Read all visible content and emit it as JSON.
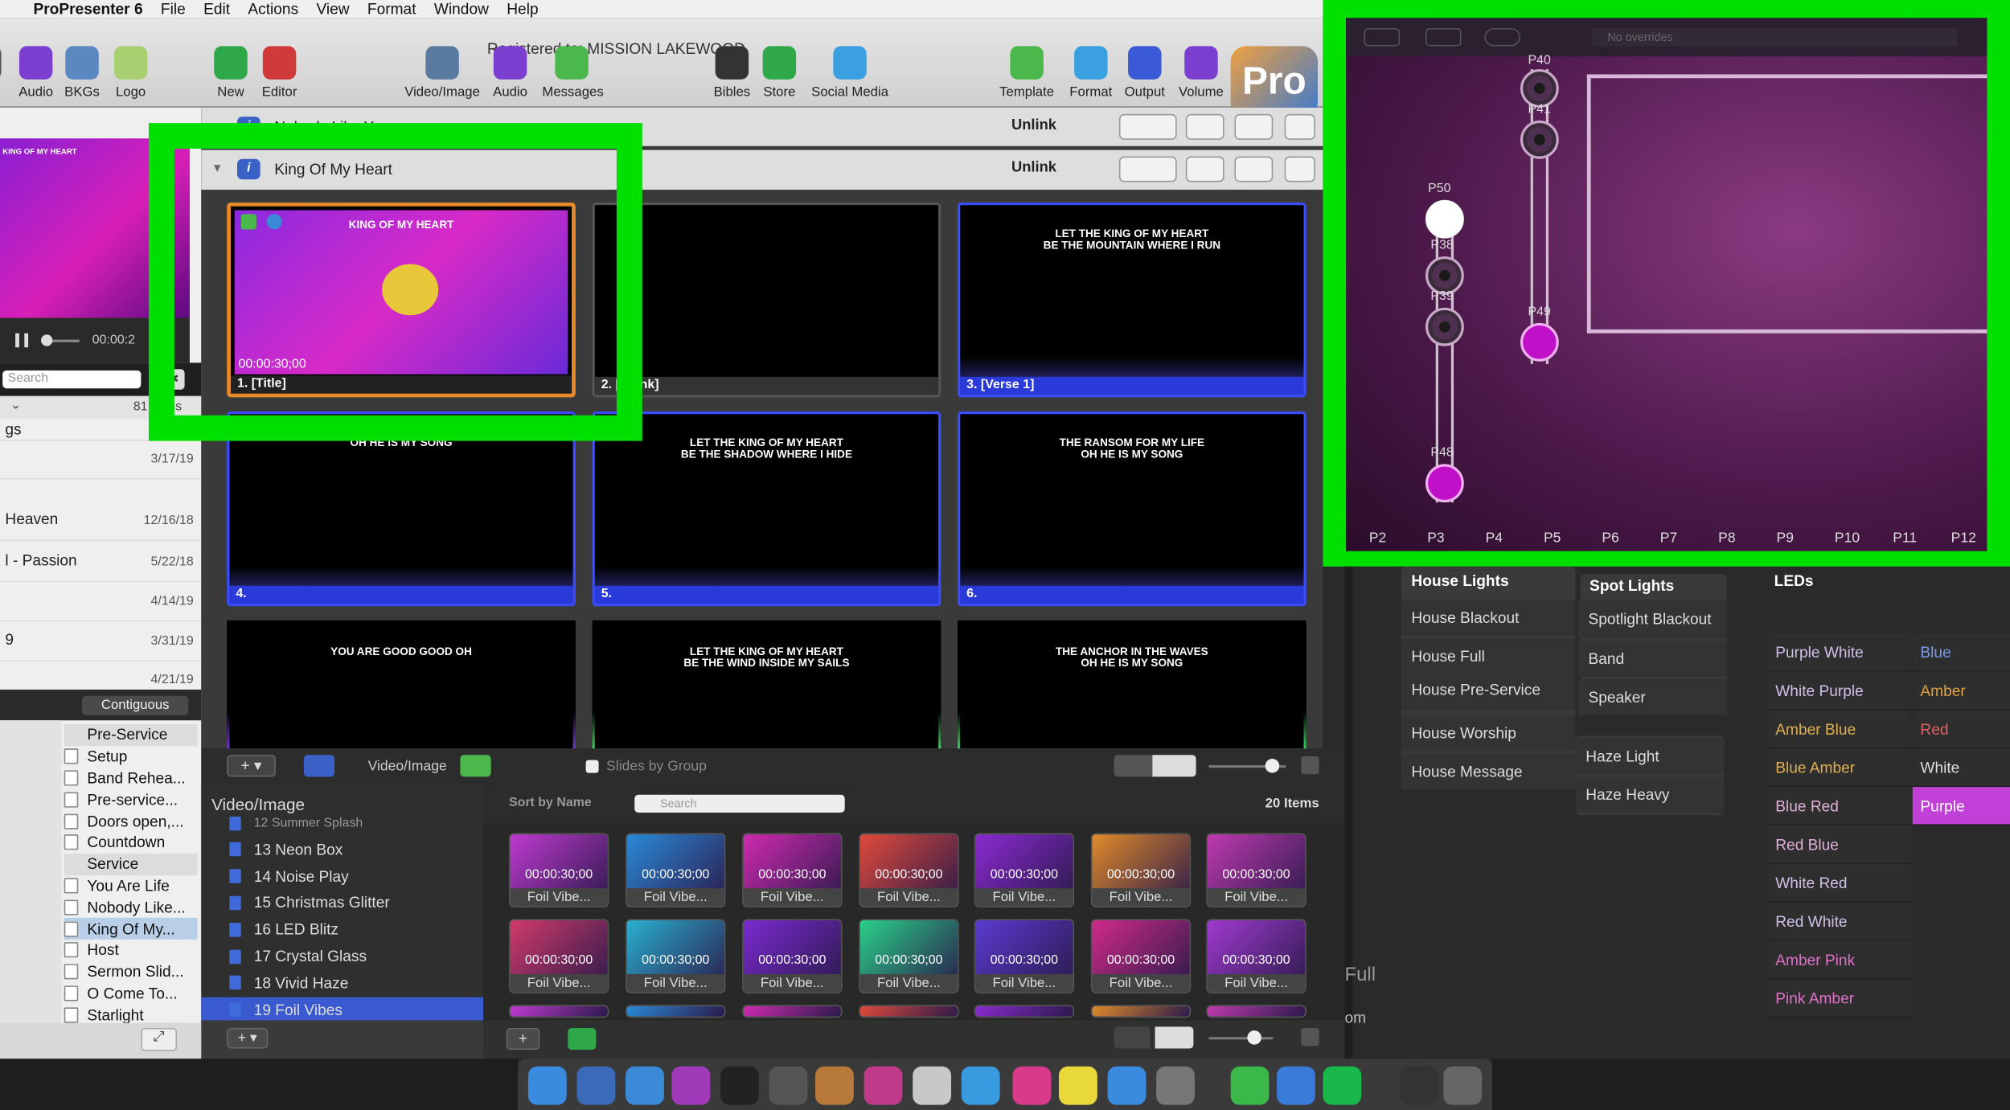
{
  "menubar": {
    "apple": "",
    "app": "ProPresenter 6",
    "items": [
      "File",
      "Edit",
      "Actions",
      "View",
      "Format",
      "Window",
      "Help"
    ]
  },
  "registered": "Registered to: MISSION LAKEWOOD",
  "toolbar": {
    "left": [
      {
        "label": "s",
        "icon": "play-icon",
        "color": "#555"
      },
      {
        "label": "Audio",
        "icon": "audio-icon",
        "color": "#7b3fd0"
      },
      {
        "label": "BKGs",
        "icon": "bkgs-icon",
        "color": "#5a88c0"
      },
      {
        "label": "Logo",
        "icon": "logo-icon",
        "color": "#a8d070"
      }
    ],
    "mid": [
      {
        "label": "New",
        "icon": "plus-icon",
        "color": "#2fa84a"
      },
      {
        "label": "Editor",
        "icon": "editor-icon",
        "color": "#d03a3a"
      }
    ],
    "media": [
      {
        "label": "Video/Image",
        "icon": "video-image-icon",
        "color": "#5a7aa0"
      },
      {
        "label": "Audio",
        "icon": "audio-icon",
        "color": "#7b3fd0"
      },
      {
        "label": "Messages",
        "icon": "messages-icon",
        "color": "#4ab84a"
      }
    ],
    "store": [
      {
        "label": "Bibles",
        "icon": "bible-icon",
        "color": "#333"
      },
      {
        "label": "Store",
        "icon": "store-icon",
        "color": "#2fa84a"
      },
      {
        "label": "Social Media",
        "icon": "social-icon",
        "color": "#3aa0e0"
      }
    ],
    "right": [
      {
        "label": "Template",
        "icon": "template-icon",
        "color": "#4ab84a"
      },
      {
        "label": "Format",
        "icon": "format-icon",
        "color": "#3aa0e0"
      },
      {
        "label": "Output",
        "icon": "output-icon",
        "color": "#3a5ad8"
      },
      {
        "label": "Volume",
        "icon": "volume-icon",
        "color": "#7b3fd0"
      }
    ],
    "pro": "Pro"
  },
  "left": {
    "preview_text": "KING OF MY HEART",
    "timecode": "00:00:2",
    "search_placeholder": "Search",
    "count": "81 items",
    "rows": [
      {
        "title": "gs",
        "date": ""
      },
      {
        "title": "",
        "date": "3/17/19"
      },
      {
        "title": " Heaven",
        "date": "12/16/18"
      },
      {
        "title": "l - Passion",
        "date": "5/22/18"
      },
      {
        "title": "",
        "date": "4/14/19"
      },
      {
        "title": "9",
        "date": "3/31/19"
      },
      {
        "title": "",
        "date": "4/21/19"
      }
    ],
    "contiguous": "Contiguous",
    "playlist": [
      {
        "label": "Pre-Service",
        "kind": "hdr"
      },
      {
        "label": "Setup",
        "kind": "doc"
      },
      {
        "label": "Band Rehea...",
        "kind": "doc"
      },
      {
        "label": "Pre-service...",
        "kind": "doc"
      },
      {
        "label": "Doors open,...",
        "kind": "doc"
      },
      {
        "label": "Countdown",
        "kind": "doc"
      },
      {
        "label": "Service",
        "kind": "hdr"
      },
      {
        "label": "You Are Life",
        "kind": "doc"
      },
      {
        "label": "Nobody Like...",
        "kind": "doc"
      },
      {
        "label": "King Of My...",
        "kind": "sel"
      },
      {
        "label": "Host",
        "kind": "doc"
      },
      {
        "label": "Sermon Slid...",
        "kind": "doc"
      },
      {
        "label": "O Come To...",
        "kind": "doc"
      },
      {
        "label": "Starlight",
        "kind": "doc"
      }
    ]
  },
  "groups": [
    {
      "name": "Nobody Like You",
      "unlink": "Unlink"
    },
    {
      "name": "King Of My Heart",
      "unlink": "Unlink"
    }
  ],
  "slides": [
    {
      "lyric": "KING OF MY HEART",
      "label": "1. [Title]",
      "time": "00:00:30;00",
      "style": "title"
    },
    {
      "lyric": "",
      "label": "2. [Blank]",
      "style": "gray"
    },
    {
      "lyric": "LET THE KING OF MY HEART\nBE THE MOUNTAIN WHERE I RUN",
      "label": "3. [Verse 1]",
      "style": "blue"
    },
    {
      "lyric": "OH HE IS MY SONG",
      "label": "4.",
      "style": "blue"
    },
    {
      "lyric": "LET THE KING OF MY HEART\nBE THE SHADOW WHERE I HIDE",
      "label": "5.",
      "style": "blue"
    },
    {
      "lyric": "THE RANSOM FOR MY LIFE\nOH HE IS MY SONG",
      "label": "6.",
      "style": "blue"
    },
    {
      "lyric": "YOU ARE GOOD GOOD OH",
      "label": "",
      "style": "purple"
    },
    {
      "lyric": "LET THE KING OF MY HEART\nBE THE WIND INSIDE MY SAILS",
      "label": "",
      "style": "green"
    },
    {
      "lyric": "THE ANCHOR IN THE WAVES\nOH HE IS MY SONG",
      "label": "",
      "style": "green"
    }
  ],
  "slidesbar": {
    "video_image": "Video/Image",
    "slides_by_group": "Slides by Group"
  },
  "media": {
    "header": "Video/Image",
    "sort": "Sort by Name",
    "search_placeholder": "Search",
    "count": "20 Items",
    "tree": [
      "12 Summer Splash",
      "13 Neon Box",
      "14 Noise Play",
      "15 Christmas Glitter",
      "16 LED Blitz",
      "17 Crystal Glass",
      "18 Vivid Haze",
      "19 Foil Vibes"
    ],
    "thumb_time": "00:00:30;00",
    "thumb_name": "Foil Vibe...",
    "thumb_colors": [
      "#c03ad0",
      "#2a8ad8",
      "#d02ab0",
      "#e04a3a",
      "#8a2ad0",
      "#e08a2a",
      "#c03ab0",
      "#d03a6a",
      "#2ab0d0",
      "#7a2ad0",
      "#2ad08a",
      "#5a3ad0",
      "#d02a8a",
      "#a03ad0"
    ]
  },
  "stage": {
    "toolbar_text": "No overrides",
    "fixtures": [
      "P40",
      "P41",
      "P50",
      "P38",
      "P39",
      "P49",
      "P48"
    ],
    "positions": [
      "P2",
      "P3",
      "P4",
      "P5",
      "P6",
      "P7",
      "P8",
      "P9",
      "P10",
      "P11",
      "P12"
    ]
  },
  "cues": {
    "house_title": "House Lights",
    "house": [
      "House Blackout",
      "House Full",
      "House Pre-Service",
      "House Worship",
      "House Message"
    ],
    "spot_title": "Spot Lights",
    "spot": [
      "Spotlight Blackout",
      "Band",
      "Speaker"
    ],
    "haze": [
      "Haze Light",
      "Haze Heavy"
    ],
    "leds_title": "LEDs",
    "leds": [
      "Purple White",
      "White Purple",
      "Amber Blue",
      "Blue Amber",
      "Blue Red",
      "Red Blue",
      "White Red",
      "Red White",
      "Amber Pink",
      "Pink Amber"
    ],
    "leds2": [
      "Blue",
      "Amber",
      "Red",
      "White",
      "Purple"
    ],
    "side_full": "Full",
    "side_om": "om"
  },
  "colors": {
    "accent_green": "#00e000",
    "slide_blue": "#2a3ad8",
    "selected_purple": "#c040d8"
  }
}
